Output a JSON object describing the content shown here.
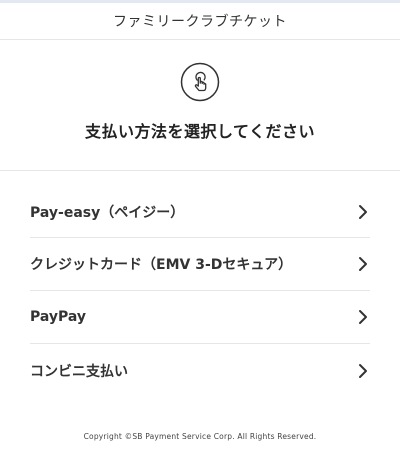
{
  "header": {
    "title": "ファミリークラブチケット"
  },
  "hero": {
    "icon": "tap-finger-icon",
    "heading": "支払い方法を選択してください"
  },
  "payment_methods": [
    {
      "label": "Pay-easy（ペイジー）",
      "icon": "chevron-right-icon"
    },
    {
      "label": "クレジットカード（EMV 3-Dセキュア）",
      "icon": "chevron-right-icon"
    },
    {
      "label": "PayPay",
      "icon": "chevron-right-icon"
    },
    {
      "label": "コンビニ支払い",
      "icon": "chevron-right-icon"
    }
  ],
  "footer": {
    "copyright": "Copyright ©SB Payment Service Corp. All Rights Reserved."
  },
  "colors": {
    "text": "#333333",
    "divider": "#e6e6e6",
    "top_strip": "#e4e8f1"
  }
}
